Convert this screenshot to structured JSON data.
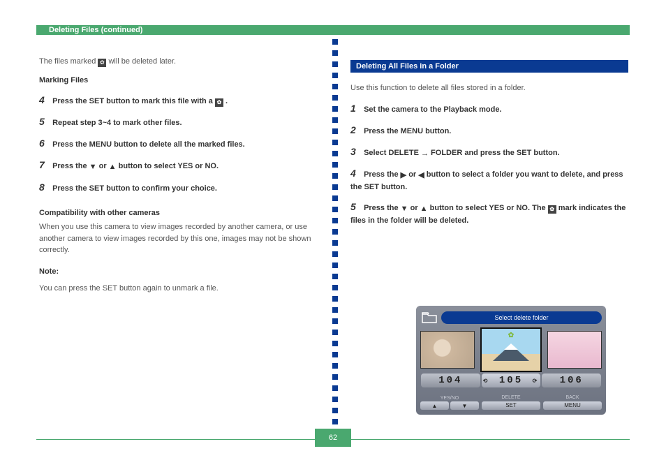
{
  "header": {
    "title": "Deleting Files (continued)"
  },
  "left": {
    "intro_a": "The files marked ",
    "intro_b": " will be deleted later.",
    "marking_files": "Marking Files",
    "step4_lead": "4 ",
    "step4_a": "Press the SET button to mark this file with a ",
    "step4_b": ".",
    "step6_lead": "6 ",
    "step6": "Press the MENU button to delete all the marked files.",
    "step5_lead": "5 ",
    "step5": "Repeat step 3~4 to mark other files.",
    "step7_lead": "7 ",
    "step7_a": "Press the ",
    "step7_b": " or ",
    "step7_c": " button to select YES or NO.",
    "step8_lead": "8 ",
    "step8": "Press the SET button to confirm your choice.",
    "compatibility": "Compatibility with other cameras",
    "compat_body": "When you use this camera to view images recorded by another camera, or use another camera to view images recorded by this one, images may not be shown correctly.",
    "note": "Note:",
    "note_body": "You can press the SET button again to unmark a file."
  },
  "right": {
    "header": "Deleting All Files in a Folder",
    "intro": "Use this function to delete all files stored in a folder.",
    "step1_lead": "1 ",
    "step1": "Set the camera to the Playback mode.",
    "step2_lead": "2 ",
    "step2": "Press the MENU button.",
    "step3_lead": "3 ",
    "step3_a": "Select DELETE ",
    "step3_b": " FOLDER and press the SET button.",
    "step4_lead": "4 ",
    "step4_a": "Press the ",
    "step4_b": " or ",
    "step4_c": " button to select a folder you want to delete, and press the SET button.",
    "step5_lead": "5 ",
    "step5_a": "Press the ",
    "step5_b": " or ",
    "step5_c": " button to select YES or NO. The ",
    "step5_d": " mark indicates the files in the folder will be deleted."
  },
  "lcd": {
    "title": "Select delete folder",
    "n1": "104",
    "n2": "105",
    "n3": "106",
    "hint_yesno": "YES/NO",
    "hint_delete": "DELETE",
    "hint_back": "BACK",
    "btn_set": "SET",
    "btn_menu": "MENU"
  },
  "page_number": "62",
  "icons": {
    "mark": "✿",
    "arrow_right": "→",
    "tri_up": "▲",
    "tri_down": "▼",
    "tri_left": "◀",
    "tri_right": "▶"
  }
}
